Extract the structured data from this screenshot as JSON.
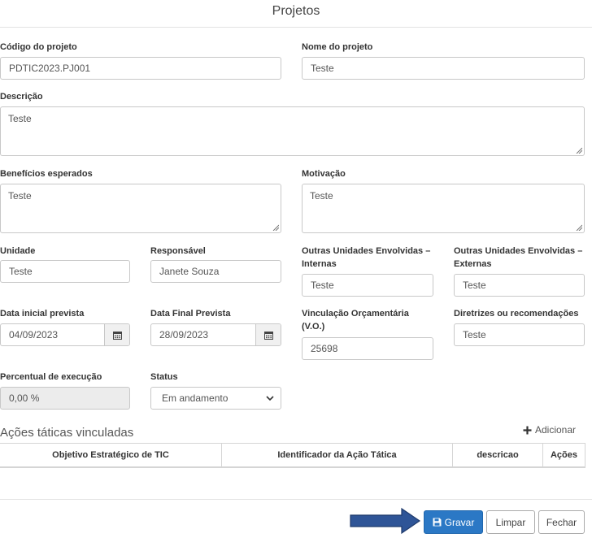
{
  "page": {
    "title": "Projetos"
  },
  "form": {
    "codigo": {
      "label": "Código do projeto",
      "value": "PDTIC2023.PJ001"
    },
    "nome": {
      "label": "Nome do projeto",
      "value": "Teste"
    },
    "descricao": {
      "label": "Descrição",
      "value": "Teste"
    },
    "beneficios": {
      "label": "Benefícios esperados",
      "value": "Teste"
    },
    "motivacao": {
      "label": "Motivação",
      "value": "Teste"
    },
    "unidade": {
      "label": "Unidade",
      "value": "Teste"
    },
    "responsavel": {
      "label": "Responsável",
      "value": "Janete Souza"
    },
    "outras_internas": {
      "label_line1": "Outras Unidades Envolvidas –",
      "label_line2": "Internas",
      "value": "Teste"
    },
    "outras_externas": {
      "label_line1": "Outras Unidades Envolvidas –",
      "label_line2": "Externas",
      "value": "Teste"
    },
    "data_inicial": {
      "label": "Data inicial prevista",
      "value": "04/09/2023",
      "icon": "calendar-icon"
    },
    "data_final": {
      "label": "Data Final Prevista",
      "value": "28/09/2023",
      "icon": "calendar-icon"
    },
    "vinculacao": {
      "label_line1": "Vinculação Orçamentária",
      "label_line2": "(V.O.)",
      "value": "25698"
    },
    "diretrizes": {
      "label": "Diretrizes ou recomendações",
      "value": "Teste"
    },
    "percentual": {
      "label": "Percentual de execução",
      "value": "0,00 %"
    },
    "status": {
      "label": "Status",
      "value": "Em andamento"
    }
  },
  "acoes": {
    "title": "Ações táticas vinculadas",
    "add_label": "Adicionar",
    "columns": [
      "Objetivo Estratégico de TIC",
      "Identificador da Ação Tática",
      "descricao",
      "Ações"
    ]
  },
  "footer": {
    "gravar": "Gravar",
    "limpar": "Limpar",
    "fechar": "Fechar",
    "colors": {
      "primary": "#2b78c5",
      "arrow": "#2f5597"
    }
  }
}
